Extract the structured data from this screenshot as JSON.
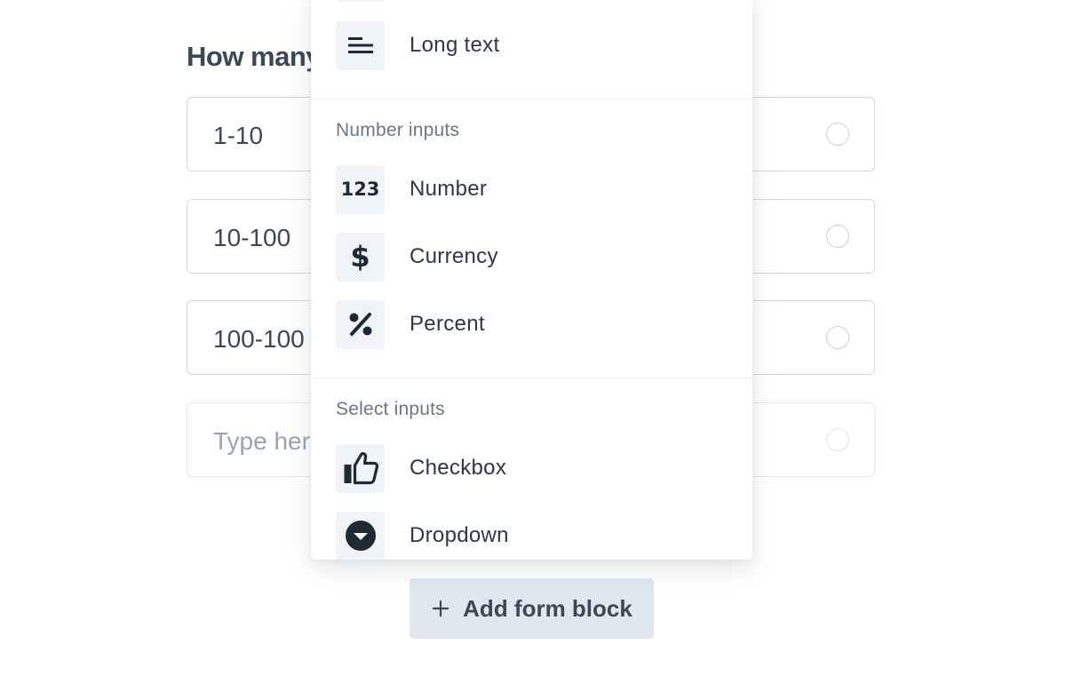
{
  "question": {
    "title": "How many"
  },
  "options": [
    {
      "label": "1-10"
    },
    {
      "label": "10-100"
    },
    {
      "label": "100-100"
    }
  ],
  "new_option": {
    "placeholder": "Type her"
  },
  "add_block": {
    "label": "Add form block",
    "icon": "plus-icon"
  },
  "menu": {
    "top_item": {
      "label": "Long text",
      "icon": "long-text-icon"
    },
    "sections": [
      {
        "label": "Number inputs",
        "items": [
          {
            "label": "Number",
            "icon": "number-icon",
            "glyph": "123"
          },
          {
            "label": "Currency",
            "icon": "dollar-icon",
            "glyph": "$"
          },
          {
            "label": "Percent",
            "icon": "percent-icon"
          }
        ]
      },
      {
        "label": "Select inputs",
        "items": [
          {
            "label": "Checkbox",
            "icon": "thumbs-up-icon"
          },
          {
            "label": "Dropdown",
            "icon": "caret-down-circle-icon"
          }
        ]
      }
    ]
  },
  "colors": {
    "text": "#2d3748",
    "muted": "#6b7787",
    "border": "#d3d9e1",
    "icon_chip": "#f0f3f7",
    "button_bg": "#e1e7ef"
  }
}
